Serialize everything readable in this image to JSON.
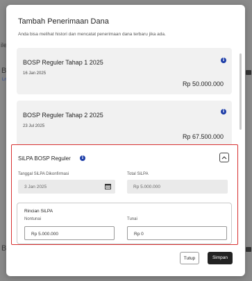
{
  "background": {
    "tab_fragment": "ile",
    "row_fragment_1": "B",
    "row_fragment_2": "Ln",
    "row_fragment_3": "B"
  },
  "modal": {
    "title": "Tambah Penerimaan Dana",
    "subtitle": "Anda bisa melihat histori dan mencatat penerimaan dana terbaru jika ada."
  },
  "funds": [
    {
      "name": "BOSP Reguler Tahap 1 2025",
      "date": "16 Jan 2025",
      "amount": "Rp 50.000.000"
    },
    {
      "name": "BOSP Reguler Tahap 2 2025",
      "date": "23 Jul 2025",
      "amount": "Rp 67.500.000"
    }
  ],
  "silpa": {
    "title": "SiLPA BOSP Reguler",
    "confirm_date_label": "Tanggal SiLPA Dikonfirmasi",
    "confirm_date_value": "3 Jan 2025",
    "total_label": "Total SiLPA",
    "total_value": "Rp 5.000.000",
    "rincian_title": "Rincian SiLPA",
    "nontunai_label": "Nontunai",
    "nontunai_value": "Rp 5.000.000",
    "tunai_label": "Tunai",
    "tunai_value": "Rp 0"
  },
  "footer": {
    "close_label": "Tutup",
    "save_label": "Simpan"
  },
  "colors": {
    "accent": "#1e3ea8",
    "highlight_border": "#d73030",
    "primary_button": "#222222"
  },
  "icons": {
    "info": "info-icon",
    "collapse": "chevron-up-icon",
    "calendar": "calendar-icon",
    "print": "print-icon"
  }
}
